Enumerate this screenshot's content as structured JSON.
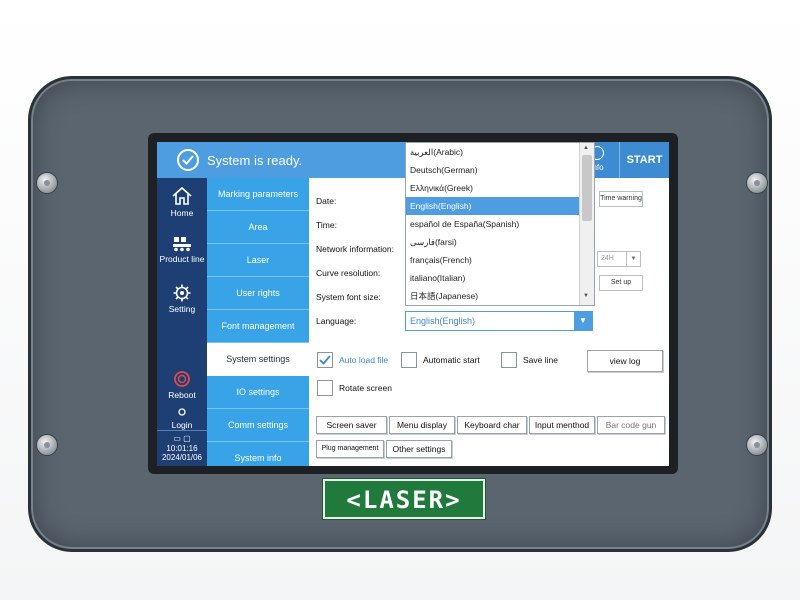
{
  "status": {
    "text": "System is ready.",
    "icon": "check-circle-icon"
  },
  "header": {
    "log_info_label": "g info",
    "start_label": "START"
  },
  "left_nav": {
    "home": "Home",
    "product_line": "Product line",
    "setting": "Setting",
    "reboot": "Reboot",
    "login": "Login",
    "time": "10:01:16",
    "date": "2024/01/06"
  },
  "sub_nav": [
    "Marking parameters",
    "Area",
    "Laser",
    "User rights",
    "Font management",
    "System settings",
    "IO settings",
    "Comm settings",
    "System info"
  ],
  "sub_nav_active": "System settings",
  "fields": {
    "date": "Date:",
    "time": "Time:",
    "network": "Network information:",
    "curve": "Curve resolution:",
    "font_size": "System font size:",
    "language": "Language:"
  },
  "language": {
    "options": [
      "العربية(Arabic)",
      "Deutsch(German)",
      "Ελληνικά(Greek)",
      "English(English)",
      "español de España(Spanish)",
      "فارسی(farsi)",
      "français(French)",
      "italiano(Italian)",
      "日本語(Japanese)"
    ],
    "selected": "English(English)"
  },
  "time_controls": {
    "time_warning": "Time warning",
    "format": "24H",
    "setup": "Set up"
  },
  "checkboxes": {
    "auto_load_file": {
      "label": "Auto load file",
      "checked": true
    },
    "automatic_start": {
      "label": "Automatic start",
      "checked": false
    },
    "save_line": {
      "label": "Save line",
      "checked": false
    },
    "rotate_screen": {
      "label": "Rotate screen",
      "checked": false
    }
  },
  "buttons": {
    "view_log": "view log",
    "screen_saver": "Screen saver",
    "menu_display": "Menu display",
    "keyboard_char": "Keyboard char",
    "input_method": "Input menthod",
    "bar_code_gun": "Bar code gun",
    "plug_management": "Plug management",
    "other_settings": "Other settings"
  },
  "badge": {
    "text": "<LASER>"
  },
  "colors": {
    "topbar": "#4d9de0",
    "left_nav": "#1d3f73",
    "sub_nav": "#38a3e6",
    "housing": "#5a6570",
    "badge": "#1f7a3c"
  }
}
